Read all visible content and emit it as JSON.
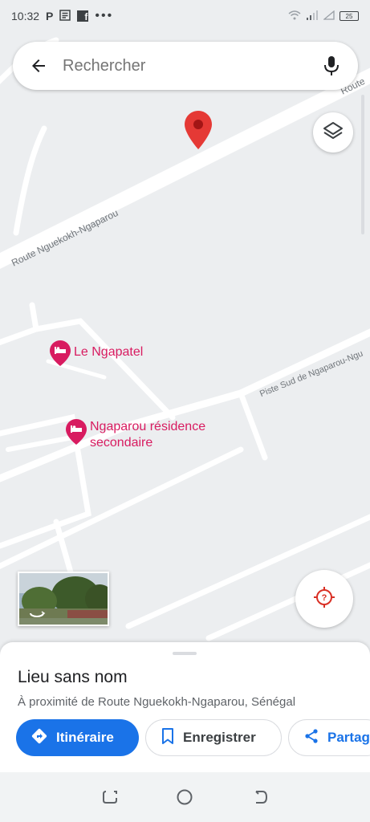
{
  "status_bar": {
    "time": "10:32",
    "app_icons": [
      "P",
      "news-icon",
      "f"
    ],
    "battery": "25"
  },
  "search": {
    "placeholder": "Rechercher",
    "icons": {
      "back": "arrow-back-icon",
      "mic": "mic-icon"
    }
  },
  "map": {
    "roads": [
      {
        "label": "Route Nguekokh-Ngaparou"
      },
      {
        "label": "Route"
      },
      {
        "label": "Piste Sud de Ngaparou-Ngu"
      }
    ],
    "pois": [
      {
        "label": "Le Ngapatel",
        "icon": "hotel-icon"
      },
      {
        "label": "Ngaparou résidence secondaire",
        "icon": "hotel-icon"
      }
    ],
    "colors": {
      "poi": "#d81b60",
      "pin": "#e53935",
      "road": "#ffffff",
      "land": "#eceef0"
    }
  },
  "place": {
    "title": "Lieu sans nom",
    "subtitle": "À proximité de Route Nguekokh-Ngaparou, Sénégal"
  },
  "actions": {
    "directions": "Itinéraire",
    "save": "Enregistrer",
    "share": "Partag"
  },
  "colors": {
    "accent": "#1a73e8"
  }
}
